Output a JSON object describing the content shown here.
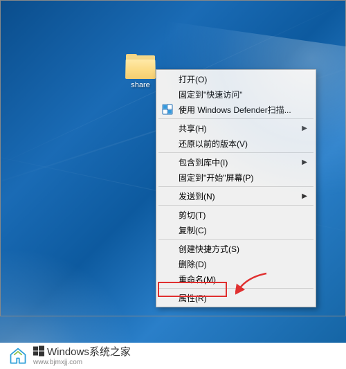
{
  "folder": {
    "name": "share"
  },
  "contextMenu": {
    "groups": [
      [
        {
          "label": "打开(O)",
          "hasSubmenu": false,
          "hasIcon": false
        },
        {
          "label": "固定到\"快速访问\"",
          "hasSubmenu": false,
          "hasIcon": false
        },
        {
          "label": "使用 Windows Defender扫描...",
          "hasSubmenu": false,
          "hasIcon": true,
          "iconType": "shield"
        }
      ],
      [
        {
          "label": "共享(H)",
          "hasSubmenu": true,
          "hasIcon": false
        },
        {
          "label": "还原以前的版本(V)",
          "hasSubmenu": false,
          "hasIcon": false
        }
      ],
      [
        {
          "label": "包含到库中(I)",
          "hasSubmenu": true,
          "hasIcon": false
        },
        {
          "label": "固定到\"开始\"屏幕(P)",
          "hasSubmenu": false,
          "hasIcon": false
        }
      ],
      [
        {
          "label": "发送到(N)",
          "hasSubmenu": true,
          "hasIcon": false
        }
      ],
      [
        {
          "label": "剪切(T)",
          "hasSubmenu": false,
          "hasIcon": false
        },
        {
          "label": "复制(C)",
          "hasSubmenu": false,
          "hasIcon": false
        }
      ],
      [
        {
          "label": "创建快捷方式(S)",
          "hasSubmenu": false,
          "hasIcon": false
        },
        {
          "label": "删除(D)",
          "hasSubmenu": false,
          "hasIcon": false
        },
        {
          "label": "重命名(M)",
          "hasSubmenu": false,
          "hasIcon": false
        }
      ],
      [
        {
          "label": "属性(R)",
          "hasSubmenu": false,
          "hasIcon": false,
          "highlighted": true
        }
      ]
    ]
  },
  "watermark": {
    "brand": "Windows",
    "title": "系统之家",
    "url": "www.bjmxjj.com"
  }
}
